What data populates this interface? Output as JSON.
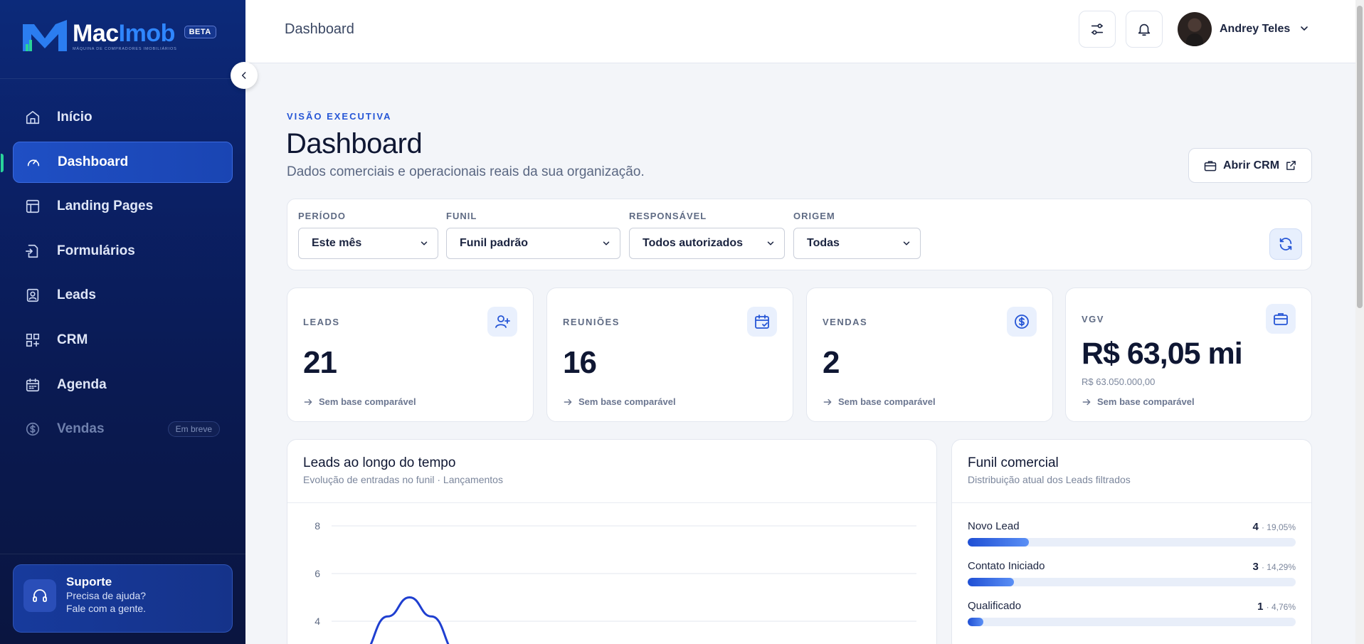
{
  "brand": {
    "name_part1": "Mac",
    "name_part2": "Imob",
    "tagline": "MÁQUINA DE COMPRADORES IMOBILIÁRIOS",
    "badge": "BETA"
  },
  "sidebar": {
    "items": [
      {
        "label": "Início",
        "icon": "home-icon"
      },
      {
        "label": "Dashboard",
        "icon": "gauge-icon",
        "active": true
      },
      {
        "label": "Landing Pages",
        "icon": "layout-icon"
      },
      {
        "label": "Formulários",
        "icon": "form-icon"
      },
      {
        "label": "Leads",
        "icon": "contact-icon"
      },
      {
        "label": "CRM",
        "icon": "grid-plus-icon"
      },
      {
        "label": "Agenda",
        "icon": "calendar-icon"
      },
      {
        "label": "Vendas",
        "icon": "dollar-circle-icon",
        "disabled": true,
        "badge": "Em breve"
      }
    ],
    "support": {
      "title": "Suporte",
      "line1": "Precisa de ajuda?",
      "line2": "Fale com a gente."
    }
  },
  "header": {
    "title": "Dashboard",
    "user_name": "Andrey Teles"
  },
  "page": {
    "eyebrow": "VISÃO EXECUTIVA",
    "title": "Dashboard",
    "subtitle": "Dados comerciais e operacionais reais da sua organização.",
    "crm_button": "Abrir CRM"
  },
  "filters": {
    "periodo": {
      "label": "PERÍODO",
      "value": "Este mês"
    },
    "funil": {
      "label": "FUNIL",
      "value": "Funil padrão"
    },
    "responsavel": {
      "label": "RESPONSÁVEL",
      "value": "Todos autorizados"
    },
    "origem": {
      "label": "ORIGEM",
      "value": "Todas"
    }
  },
  "kpis": [
    {
      "label": "LEADS",
      "value": "21",
      "foot": "Sem base comparável",
      "icon": "user-plus-icon"
    },
    {
      "label": "REUNIÕES",
      "value": "16",
      "foot": "Sem base comparável",
      "icon": "calendar-check-icon"
    },
    {
      "label": "VENDAS",
      "value": "2",
      "foot": "Sem base comparável",
      "icon": "dollar-circle-icon"
    },
    {
      "label": "VGV",
      "value": "R$ 63,05 mi",
      "subvalue": "R$ 63.050.000,00",
      "foot": "Sem base comparável",
      "icon": "briefcase-icon"
    }
  ],
  "leads_chart": {
    "title": "Leads ao longo do tempo",
    "subtitle": "Evolução de entradas no funil · Lançamentos"
  },
  "chart_data": {
    "type": "line",
    "title": "Leads ao longo do tempo",
    "yticks": [
      4,
      6,
      8
    ],
    "ylim": [
      2.6,
      8.4
    ],
    "grid": true,
    "series": [
      {
        "points": [
          [
            0,
            2.6
          ],
          [
            0.55,
            4.2
          ],
          [
            1,
            5.0
          ],
          [
            1.45,
            4.2
          ],
          [
            2,
            2.6
          ]
        ]
      }
    ],
    "xlim": [
      0,
      12
    ],
    "color": "#1f3fd0"
  },
  "funnel": {
    "title": "Funil comercial",
    "subtitle": "Distribuição atual dos Leads filtrados",
    "stages": [
      {
        "name": "Novo Lead",
        "count": "4",
        "pct": "· 19,05%",
        "fraction": 0.1905
      },
      {
        "name": "Contato Iniciado",
        "count": "3",
        "pct": "· 14,29%",
        "fraction": 0.1429
      },
      {
        "name": "Qualificado",
        "count": "1",
        "pct": "· 4,76%",
        "fraction": 0.0476
      }
    ]
  },
  "colors": {
    "accent": "#2656d6",
    "sidebar": "#0b2168",
    "active_marker": "#29d39a"
  }
}
